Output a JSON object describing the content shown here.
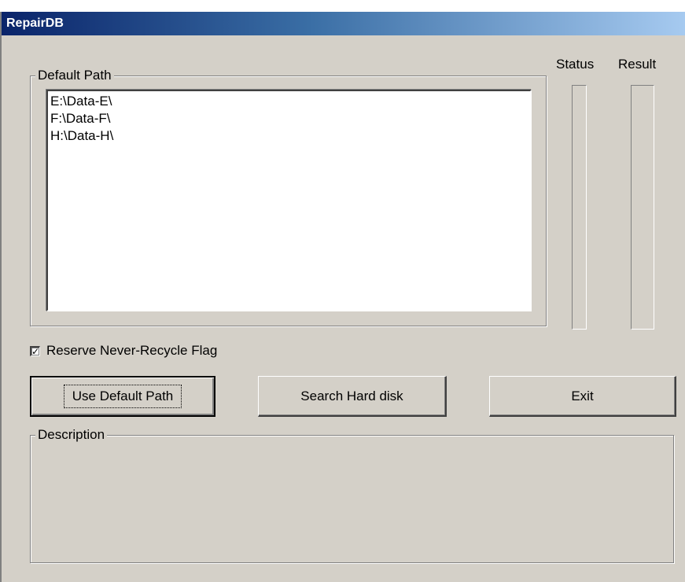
{
  "window": {
    "title": "RepairDB"
  },
  "default_path_group": {
    "label": "Default Path",
    "paths": [
      "E:\\Data-E\\",
      "F:\\Data-F\\",
      "H:\\Data-H\\"
    ]
  },
  "columns": {
    "status_label": "Status",
    "result_label": "Result"
  },
  "options": {
    "reserve_flag_label": "Reserve Never-Recycle Flag",
    "reserve_flag_checked": true
  },
  "buttons": {
    "use_default_path": "Use Default Path",
    "search_hard_disk": "Search Hard disk",
    "exit": "Exit"
  },
  "description_group": {
    "label": "Description",
    "text": ""
  },
  "colors": {
    "face": "#d4d0c8",
    "title_start": "#0a246a",
    "title_end": "#a6caf0"
  }
}
